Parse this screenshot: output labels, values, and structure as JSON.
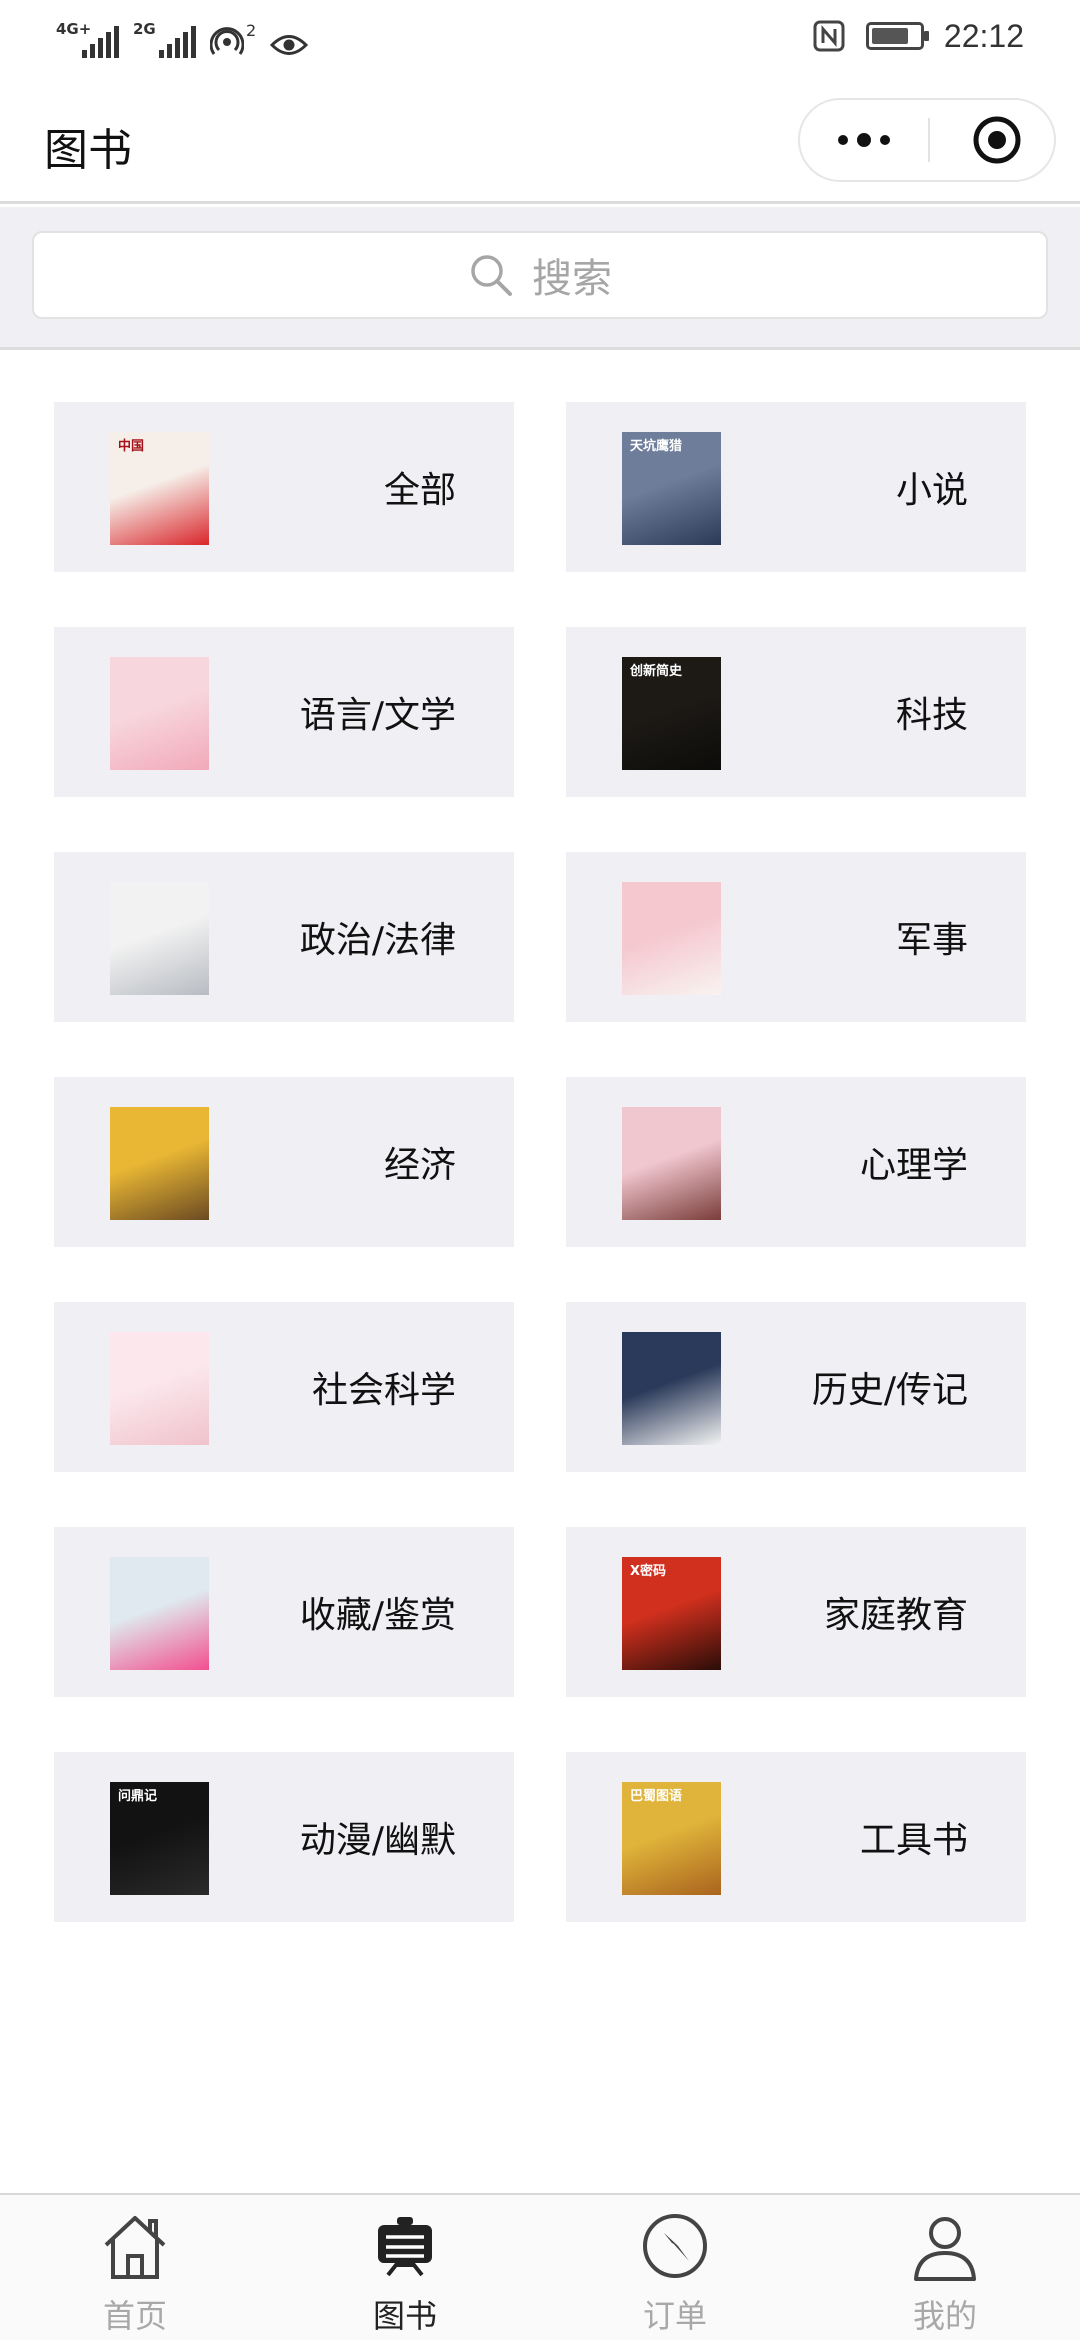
{
  "status_bar": {
    "network_1": "4G+",
    "network_2": "2G",
    "hotspot_count": "2",
    "time": "22:12",
    "battery_level": 0.7,
    "icons": [
      "signal-icon",
      "hotspot-icon",
      "eye-icon",
      "nfc-icon",
      "battery-icon"
    ]
  },
  "header": {
    "title": "图书",
    "capsule_icons": [
      "more-icon",
      "target-icon"
    ]
  },
  "search": {
    "placeholder": "搜索",
    "icon": "search-icon"
  },
  "categories": [
    {
      "label": "全部",
      "cover_title": "中国",
      "cover_colors": [
        "#f6efe9",
        "#d9262b"
      ]
    },
    {
      "label": "小说",
      "cover_title": "天坑鹰猎",
      "cover_colors": [
        "#6e7e9a",
        "#2c3a58"
      ]
    },
    {
      "label": "语言/文学",
      "cover_title": "",
      "cover_colors": [
        "#f7d6dd",
        "#f2a9b9"
      ]
    },
    {
      "label": "科技",
      "cover_title": "创新简史",
      "cover_colors": [
        "#1d1a16",
        "#0d0c0a"
      ]
    },
    {
      "label": "政治/法律",
      "cover_title": "",
      "cover_colors": [
        "#f2f2f2",
        "#b8bcc2"
      ]
    },
    {
      "label": "军事",
      "cover_title": "",
      "cover_colors": [
        "#f5c8cf",
        "#f8f3f1"
      ]
    },
    {
      "label": "经济",
      "cover_title": "",
      "cover_colors": [
        "#e9b734",
        "#6b4a22"
      ]
    },
    {
      "label": "心理学",
      "cover_title": "",
      "cover_colors": [
        "#f1c7cf",
        "#7a3d3a"
      ]
    },
    {
      "label": "社会科学",
      "cover_title": "",
      "cover_colors": [
        "#fbe7ec",
        "#f0c2cc"
      ]
    },
    {
      "label": "历史/传记",
      "cover_title": "",
      "cover_colors": [
        "#2b3a5a",
        "#f4f4f4"
      ]
    },
    {
      "label": "收藏/鉴赏",
      "cover_title": "",
      "cover_colors": [
        "#dfe9ef",
        "#f24f8f"
      ]
    },
    {
      "label": "家庭教育",
      "cover_title": "X密码",
      "cover_colors": [
        "#d2301e",
        "#2a0d08"
      ]
    },
    {
      "label": "动漫/幽默",
      "cover_title": "问鼎记",
      "cover_colors": [
        "#121212",
        "#2a2a2a"
      ]
    },
    {
      "label": "工具书",
      "cover_title": "巴蜀图语",
      "cover_colors": [
        "#e0b43a",
        "#a9641e"
      ]
    }
  ],
  "tabbar": {
    "tabs": [
      {
        "label": "首页",
        "icon": "home-icon",
        "active": false
      },
      {
        "label": "图书",
        "icon": "book-icon",
        "active": true
      },
      {
        "label": "订单",
        "icon": "compass-icon",
        "active": false
      },
      {
        "label": "我的",
        "icon": "profile-icon",
        "active": false
      }
    ]
  },
  "colors": {
    "card_bg": "#efeff4",
    "tab_active": "#222222",
    "tab_inactive": "#a8a8a8"
  }
}
